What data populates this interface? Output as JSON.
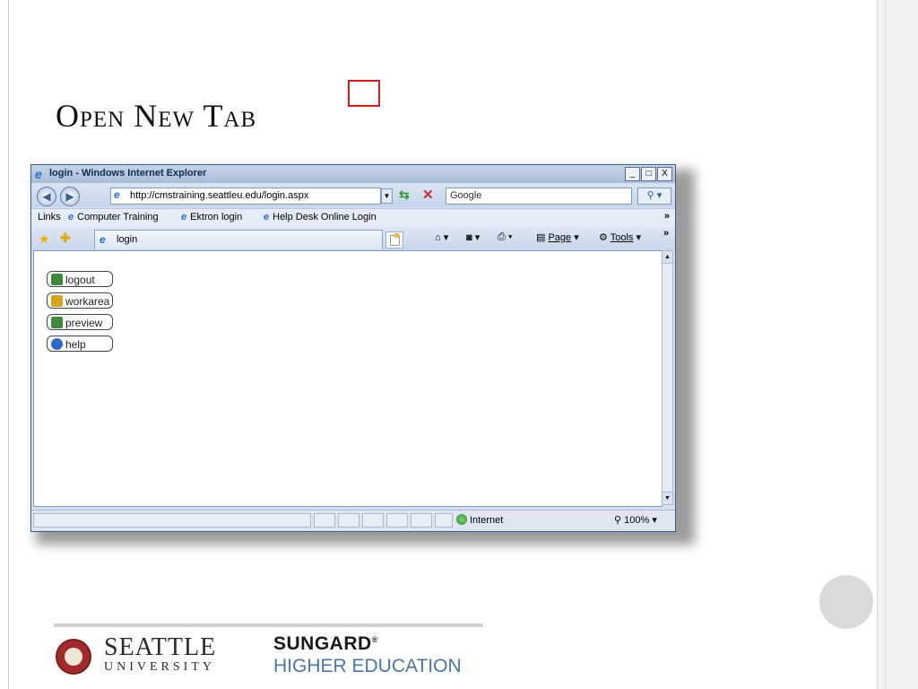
{
  "slide": {
    "title": "Open New Tab"
  },
  "browser": {
    "window_title": "login - Windows Internet Explorer",
    "window_buttons": {
      "minimize": "_",
      "maximize": "□",
      "close": "X"
    },
    "address": "http://cmstraining.seattleu.edu/login.aspx",
    "search_placeholder": "Google",
    "links_bar": {
      "label": "Links",
      "items": [
        "Computer Training",
        "Ektron login",
        "Help Desk Online Login"
      ],
      "more": "»"
    },
    "tab": {
      "label": "login"
    },
    "command_bar": {
      "page_label": "Page",
      "tools_label": "Tools",
      "more": "»"
    },
    "content_buttons": [
      {
        "label": "logout",
        "icon": "logout-icon",
        "color": "#3c8a3c"
      },
      {
        "label": "workarea",
        "icon": "workarea-icon",
        "color": "#d9a21a"
      },
      {
        "label": "preview",
        "icon": "preview-icon",
        "color": "#3c8a3c"
      },
      {
        "label": "help",
        "icon": "help-icon",
        "color": "#2a6ac8"
      }
    ],
    "status": {
      "zone": "Internet",
      "zoom": "100%"
    },
    "highlight_color": "#d21c1c"
  },
  "footer": {
    "seattle": "SEATTLE",
    "university": "UNIVERSITY",
    "sungard": "SUNGARD",
    "higher_education": "HIGHER EDUCATION"
  }
}
